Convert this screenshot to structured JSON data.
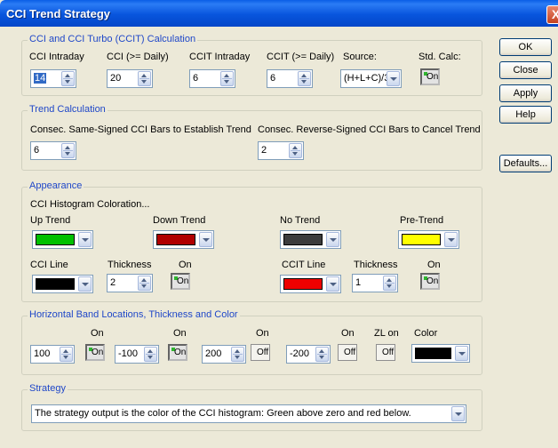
{
  "window": {
    "title": "CCI Trend Strategy",
    "close_glyph": "X"
  },
  "buttons": {
    "ok": "OK",
    "close": "Close",
    "apply": "Apply",
    "help": "Help",
    "defaults": "Defaults..."
  },
  "calc": {
    "legend": "CCI and CCI Turbo (CCIT) Calculation",
    "cci_intraday": {
      "label": "CCI Intraday",
      "value": "14"
    },
    "cci_daily": {
      "label": "CCI (>= Daily)",
      "value": "20"
    },
    "ccit_intraday": {
      "label": "CCIT Intraday",
      "value": "6"
    },
    "ccit_daily": {
      "label": "CCIT (>= Daily)",
      "value": "6"
    },
    "source": {
      "label": "Source:",
      "value": "(H+L+C)/3"
    },
    "std_calc": {
      "label": "Std. Calc:",
      "state": "On"
    }
  },
  "trend": {
    "legend": "Trend Calculation",
    "same_label": "Consec. Same-Signed CCI Bars to Establish Trend",
    "same_value": "6",
    "reverse_label": "Consec. Reverse-Signed CCI Bars to Cancel Trend",
    "reverse_value": "2"
  },
  "appearance": {
    "legend": "Appearance",
    "coloration_label": "CCI Histogram Coloration...",
    "up_trend": {
      "label": "Up Trend",
      "color": "#00c000"
    },
    "down_trend": {
      "label": "Down Trend",
      "color": "#b00000"
    },
    "no_trend": {
      "label": "No Trend",
      "color": "#3c3c3c"
    },
    "pre_trend": {
      "label": "Pre-Trend",
      "color": "#ffff00"
    },
    "cci_line": {
      "label": "CCI Line",
      "color": "#000000",
      "thickness_label": "Thickness",
      "thickness": "2",
      "on_label": "On",
      "state": "On"
    },
    "ccit_line": {
      "label": "CCIT Line",
      "color": "#ee0000",
      "thickness_label": "Thickness",
      "thickness": "1",
      "on_label": "On",
      "state": "On"
    }
  },
  "bands": {
    "legend": "Horizontal Band Locations, Thickness and Color",
    "on_label": "On",
    "zl_label": "ZL on",
    "color_label": "Color",
    "items": [
      {
        "value": "100",
        "state": "On"
      },
      {
        "value": "-100",
        "state": "On"
      },
      {
        "value": "200",
        "state": "Off"
      },
      {
        "value": "-200",
        "state": "Off"
      }
    ],
    "zl_state": "Off",
    "color": "#000000"
  },
  "strategy": {
    "legend": "Strategy",
    "value": "The strategy output is the color of the CCI histogram: Green above zero and red below."
  }
}
